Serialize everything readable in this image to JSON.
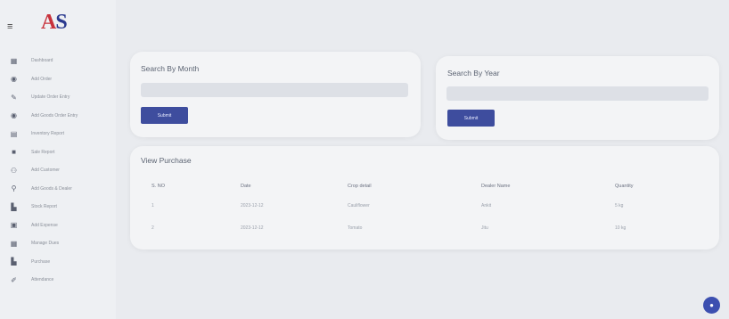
{
  "header": {
    "menu_icon": "≡",
    "logo_a": "A",
    "logo_s": "S",
    "logo_sub": ""
  },
  "sidebar": {
    "items": [
      {
        "icon": "grid-icon",
        "glyph": "▦",
        "label": "Dashboard"
      },
      {
        "icon": "circle-icon",
        "glyph": "◉",
        "label": "Add Order"
      },
      {
        "icon": "pencil-icon",
        "glyph": "✎",
        "label": "Update Order Entry"
      },
      {
        "icon": "circle-icon",
        "glyph": "◉",
        "label": "Add Goods Order Entry"
      },
      {
        "icon": "list-icon",
        "glyph": "▤",
        "label": "Inventory Report"
      },
      {
        "icon": "box-icon",
        "glyph": "■",
        "label": "Sale Report"
      },
      {
        "icon": "people-icon",
        "glyph": "⚇",
        "label": "Add Customer"
      },
      {
        "icon": "user-add-icon",
        "glyph": "⚲",
        "label": "Add Goods & Dealer"
      },
      {
        "icon": "chart-icon",
        "glyph": "▙",
        "label": "Stock Report"
      },
      {
        "icon": "table-icon",
        "glyph": "▣",
        "label": "Add Expense"
      },
      {
        "icon": "calendar-icon",
        "glyph": "▦",
        "label": "Manage Dues"
      },
      {
        "icon": "bar-chart-icon",
        "glyph": "▙",
        "label": "Purchase"
      },
      {
        "icon": "pen-icon",
        "glyph": "✐",
        "label": "Attendance"
      }
    ]
  },
  "search_month": {
    "title": "Search By Month",
    "placeholder": "",
    "button": "Submit"
  },
  "search_year": {
    "title": "Search By Year",
    "placeholder": "",
    "button": "Submit"
  },
  "purchase": {
    "title": "View Purchase",
    "headers": [
      "S. NO",
      "Date",
      "Crop detail",
      "Dealer Name",
      "Quantity"
    ],
    "rows": [
      [
        "1",
        "2023-12-12",
        "Cauliflower",
        "Ankit",
        "5 kg"
      ],
      [
        "2",
        "2023-12-12",
        "Tomato",
        "Jitu",
        "10 kg"
      ]
    ]
  },
  "fab": {
    "glyph": "●"
  }
}
